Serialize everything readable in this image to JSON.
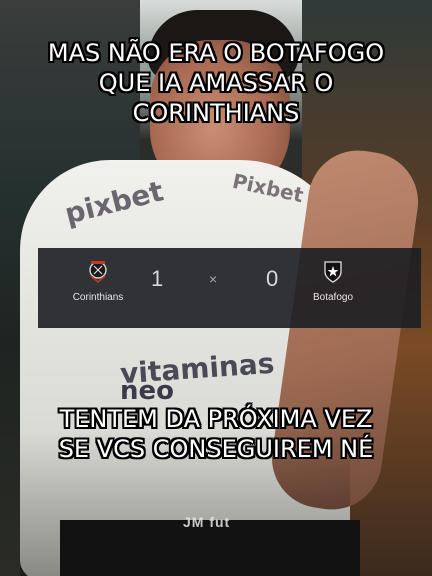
{
  "caption_top": {
    "line1": "MAS NÃO ERA O BOTAFOGO",
    "line2": "QUE IA AMASSAR O",
    "line3": "CORINTHIANS"
  },
  "caption_bottom": {
    "line1": "TENTEM DA PRÓXIMA VEZ",
    "line2": "SE VCS CONSEGUIREM NÉ"
  },
  "scoreboard": {
    "home_team": "Corinthians",
    "home_score": "1",
    "separator": "×",
    "away_score": "0",
    "away_team": "Botafogo",
    "home_crest_icon": "corinthians-crest-icon",
    "away_crest_icon": "botafogo-star-crest-icon"
  },
  "shirt": {
    "sponsor_front": "pixbet",
    "sponsor_shoulder": "Pixbet",
    "sponsor_chest_1": "vitaminas",
    "sponsor_chest_2": "neo"
  },
  "watermark": "JM fut",
  "colors": {
    "caption_text": "#ffffff",
    "caption_outline": "#000000",
    "scoreboard_bg": "#1c1e22",
    "scoreboard_text": "#e6e6e6"
  }
}
